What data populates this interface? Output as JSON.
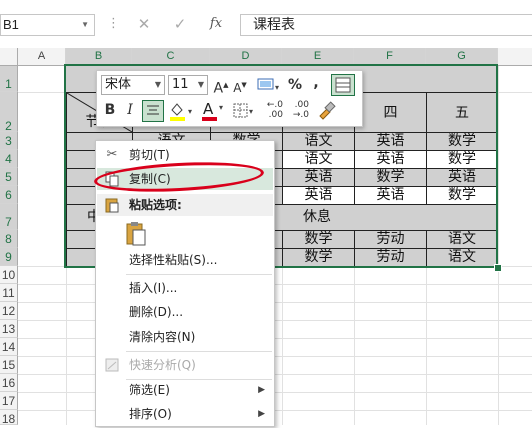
{
  "formula_bar": {
    "name_box": "B1",
    "cancel_symbol": "✕",
    "enter_symbol": "✓",
    "fx_label": "fx",
    "content": "课程表"
  },
  "columns": [
    "A",
    "B",
    "C",
    "D",
    "E",
    "F",
    "G"
  ],
  "rows": [
    "1",
    "2",
    "3",
    "4",
    "5",
    "6",
    "7",
    "8",
    "9",
    "10",
    "11",
    "12",
    "13",
    "14",
    "15",
    "16",
    "17",
    "18"
  ],
  "table": {
    "title": "",
    "header_days": [
      "",
      "",
      "",
      "",
      "四",
      "五"
    ],
    "corner_label": "节次",
    "rows": [
      [
        "",
        "语文",
        "数学",
        "语文",
        "英语",
        "数学"
      ],
      [
        "",
        "",
        "",
        "语文",
        "英语",
        "数学"
      ],
      [
        "",
        "",
        "",
        "英语",
        "数学",
        "英语"
      ],
      [
        "",
        "",
        "",
        "英语",
        "英语",
        "数学"
      ]
    ],
    "rest_label_left": "中",
    "rest_label": "休息",
    "afternoon": [
      [
        "",
        "",
        "",
        "数学",
        "劳动",
        "语文"
      ],
      [
        "",
        "",
        "",
        "数学",
        "劳动",
        "语文"
      ]
    ]
  },
  "mini_toolbar": {
    "font_name": "宋体",
    "font_size": "11",
    "grow_font": "A",
    "shrink_font": "A",
    "percent": "%",
    "comma": ",",
    "bold": "B",
    "italic": "I",
    "font_color_letter": "A",
    "decimal_inc": ".00",
    "decimal_dec": ".0",
    "font_color": "#d9001b",
    "highlight_color": "#ffff00"
  },
  "context_menu": {
    "items": [
      {
        "label": "剪切(T)",
        "icon": "scissors-icon"
      },
      {
        "label": "复制(C)",
        "icon": "copy-icon",
        "highlighted": true
      },
      {
        "label": "粘贴选项:",
        "icon": "paste-icon",
        "section": true
      },
      {
        "label": "选择性粘贴(S)...",
        "icon": ""
      },
      {
        "label": "插入(I)...",
        "icon": ""
      },
      {
        "label": "删除(D)...",
        "icon": ""
      },
      {
        "label": "清除内容(N)",
        "icon": ""
      },
      {
        "label": "快速分析(Q)",
        "icon": "quick-analysis-icon",
        "disabled": true
      },
      {
        "label": "筛选(E)",
        "icon": "",
        "submenu": true
      },
      {
        "label": "排序(O)",
        "icon": "",
        "submenu": true
      }
    ]
  },
  "accent_color": "#217346",
  "highlight_ring_color": "#d9001b"
}
